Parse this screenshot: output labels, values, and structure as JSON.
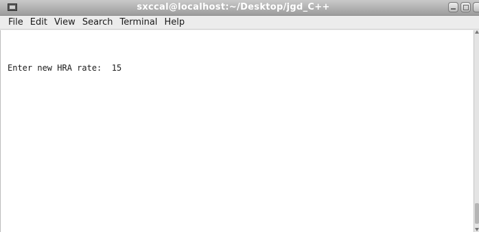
{
  "window": {
    "title": "sxccal@localhost:~/Desktop/jgd_C++",
    "icon": "terminal-icon"
  },
  "menu": {
    "items": [
      "File",
      "Edit",
      "View",
      "Search",
      "Terminal",
      "Help"
    ]
  },
  "terminal": {
    "prompt": "Enter new HRA rate:",
    "input_value": "15",
    "line": "Enter new HRA rate:  15"
  },
  "colors": {
    "titlebar": "#9c9c9c",
    "title_text": "#ffffff",
    "terminal_bg": "#ffffff",
    "terminal_text": "#1a1a1a"
  }
}
